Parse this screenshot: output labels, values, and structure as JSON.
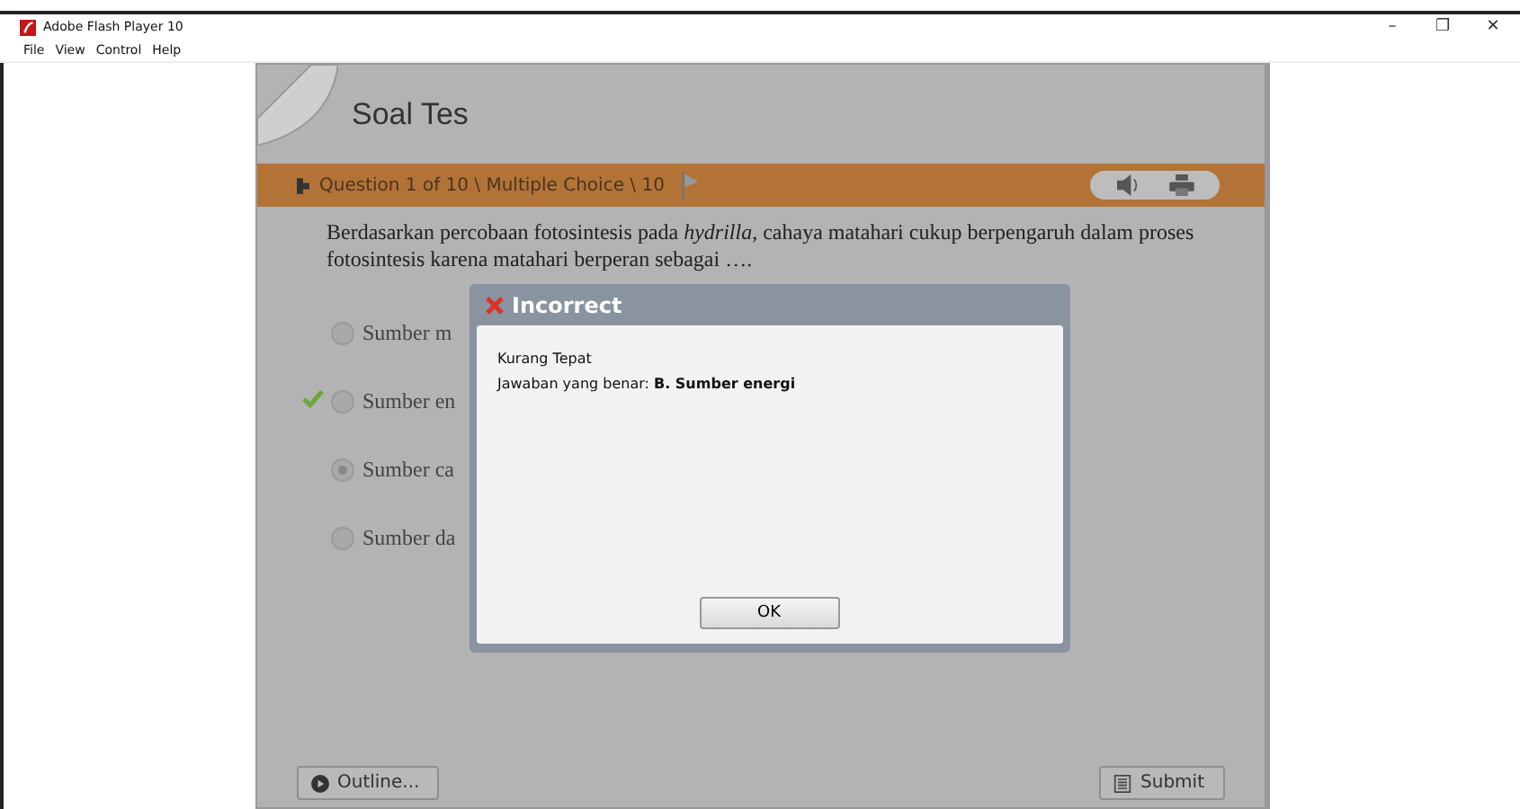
{
  "window": {
    "title": "Adobe Flash Player 10",
    "controls": [
      "–",
      "❐",
      "✕"
    ]
  },
  "menu": [
    "File",
    "View",
    "Control",
    "Help"
  ],
  "quiz": {
    "title": "Soal Tes",
    "question_bar": "Question 1 of 10 \\ Multiple Choice \\ 10",
    "question": "Berdasarkan percobaan fotosintesis pada *hydrilla*, cahaya matahari cukup berpengaruh dalam proses fotosintesis karena matahari berperan sebagai ….",
    "options": [
      {
        "label": "Sumber m",
        "selected": false,
        "correct": false
      },
      {
        "label": "Sumber en",
        "selected": false,
        "correct": true
      },
      {
        "label": "Sumber ca",
        "selected": true,
        "correct": false
      },
      {
        "label": "Sumber da",
        "selected": false,
        "correct": false
      }
    ],
    "outline_button": "Outline...",
    "submit_button": "Submit"
  },
  "dialog": {
    "title": "Incorrect",
    "lines": [
      "Kurang Tepat",
      "Jawaban yang benar: **B. Sumber energi**"
    ],
    "button": "OK"
  }
}
